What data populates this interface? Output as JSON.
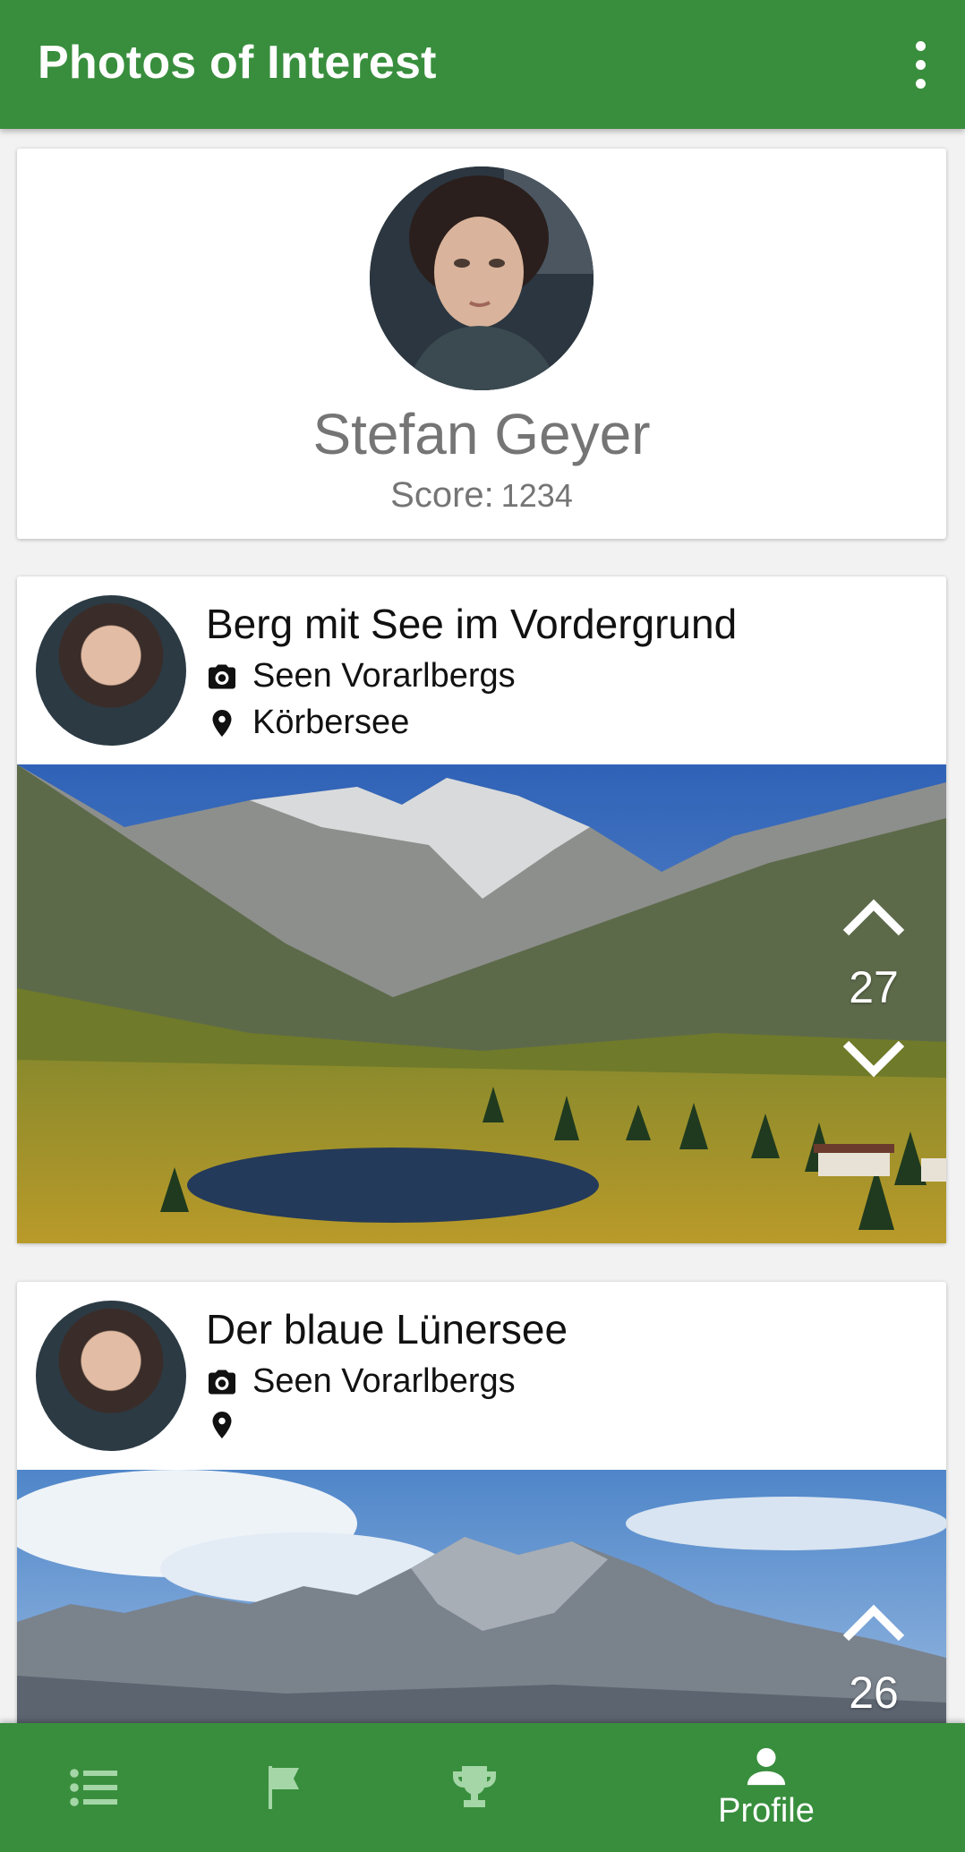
{
  "app": {
    "title": "Photos of Interest"
  },
  "profile": {
    "name": "Stefan Geyer",
    "score_label": "Score:",
    "score_value": "1234"
  },
  "posts": [
    {
      "title": "Berg mit See im Vordergrund",
      "category": "Seen Vorarlbergs",
      "location": "Körbersee",
      "votes": "27"
    },
    {
      "title": "Der blaue Lünersee",
      "category": "Seen Vorarlbergs",
      "location": "",
      "votes": "26"
    }
  ],
  "bottom_nav": {
    "active_label": "Profile"
  },
  "colors": {
    "primary": "#388e3c",
    "nav_inactive": "#a5d6a7"
  },
  "icons": [
    "more-vert-icon",
    "camera-icon",
    "location-pin-icon",
    "chevron-up-icon",
    "chevron-down-icon",
    "list-icon",
    "flag-icon",
    "trophy-icon",
    "person-icon"
  ]
}
